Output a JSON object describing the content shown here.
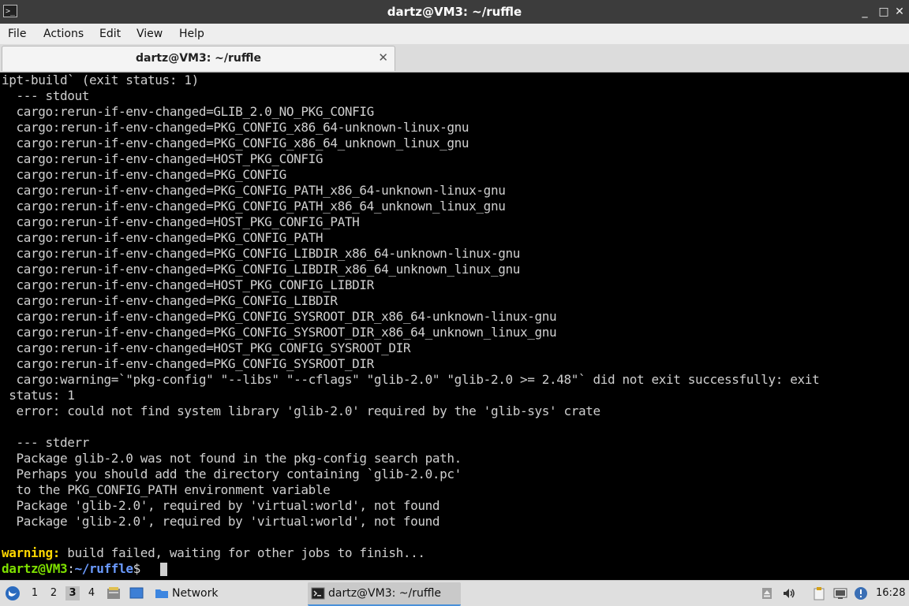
{
  "window": {
    "title": "dartz@VM3: ~/ruffle",
    "controls": {
      "minimize": "_",
      "maximize": "□",
      "close": "✕"
    }
  },
  "menu": [
    "File",
    "Actions",
    "Edit",
    "View",
    "Help"
  ],
  "tab": {
    "label": "dartz@VM3: ~/ruffle",
    "close": "✕"
  },
  "terminal": {
    "lines": [
      "ipt-build` (exit status: 1)",
      "  --- stdout",
      "  cargo:rerun-if-env-changed=GLIB_2.0_NO_PKG_CONFIG",
      "  cargo:rerun-if-env-changed=PKG_CONFIG_x86_64-unknown-linux-gnu",
      "  cargo:rerun-if-env-changed=PKG_CONFIG_x86_64_unknown_linux_gnu",
      "  cargo:rerun-if-env-changed=HOST_PKG_CONFIG",
      "  cargo:rerun-if-env-changed=PKG_CONFIG",
      "  cargo:rerun-if-env-changed=PKG_CONFIG_PATH_x86_64-unknown-linux-gnu",
      "  cargo:rerun-if-env-changed=PKG_CONFIG_PATH_x86_64_unknown_linux_gnu",
      "  cargo:rerun-if-env-changed=HOST_PKG_CONFIG_PATH",
      "  cargo:rerun-if-env-changed=PKG_CONFIG_PATH",
      "  cargo:rerun-if-env-changed=PKG_CONFIG_LIBDIR_x86_64-unknown-linux-gnu",
      "  cargo:rerun-if-env-changed=PKG_CONFIG_LIBDIR_x86_64_unknown_linux_gnu",
      "  cargo:rerun-if-env-changed=HOST_PKG_CONFIG_LIBDIR",
      "  cargo:rerun-if-env-changed=PKG_CONFIG_LIBDIR",
      "  cargo:rerun-if-env-changed=PKG_CONFIG_SYSROOT_DIR_x86_64-unknown-linux-gnu",
      "  cargo:rerun-if-env-changed=PKG_CONFIG_SYSROOT_DIR_x86_64_unknown_linux_gnu",
      "  cargo:rerun-if-env-changed=HOST_PKG_CONFIG_SYSROOT_DIR",
      "  cargo:rerun-if-env-changed=PKG_CONFIG_SYSROOT_DIR",
      "  cargo:warning=`\"pkg-config\" \"--libs\" \"--cflags\" \"glib-2.0\" \"glib-2.0 >= 2.48\"` did not exit successfully: exit",
      " status: 1",
      "  error: could not find system library 'glib-2.0' required by the 'glib-sys' crate",
      "",
      "  --- stderr",
      "  Package glib-2.0 was not found in the pkg-config search path.",
      "  Perhaps you should add the directory containing `glib-2.0.pc'",
      "  to the PKG_CONFIG_PATH environment variable",
      "  Package 'glib-2.0', required by 'virtual:world', not found",
      "  Package 'glib-2.0', required by 'virtual:world', not found",
      ""
    ],
    "warning_label": "warning:",
    "warning_text": " build failed, waiting for other jobs to finish...",
    "prompt_user": "dartz@VM3",
    "prompt_sep": ":",
    "prompt_path": "~/ruffle",
    "prompt_symbol": "$"
  },
  "taskbar": {
    "workspaces": [
      "1",
      "2",
      "3",
      "4"
    ],
    "active_workspace": "3",
    "network_label": "Network",
    "task_label": "dartz@VM3: ~/ruffle",
    "clock": "16:28"
  }
}
